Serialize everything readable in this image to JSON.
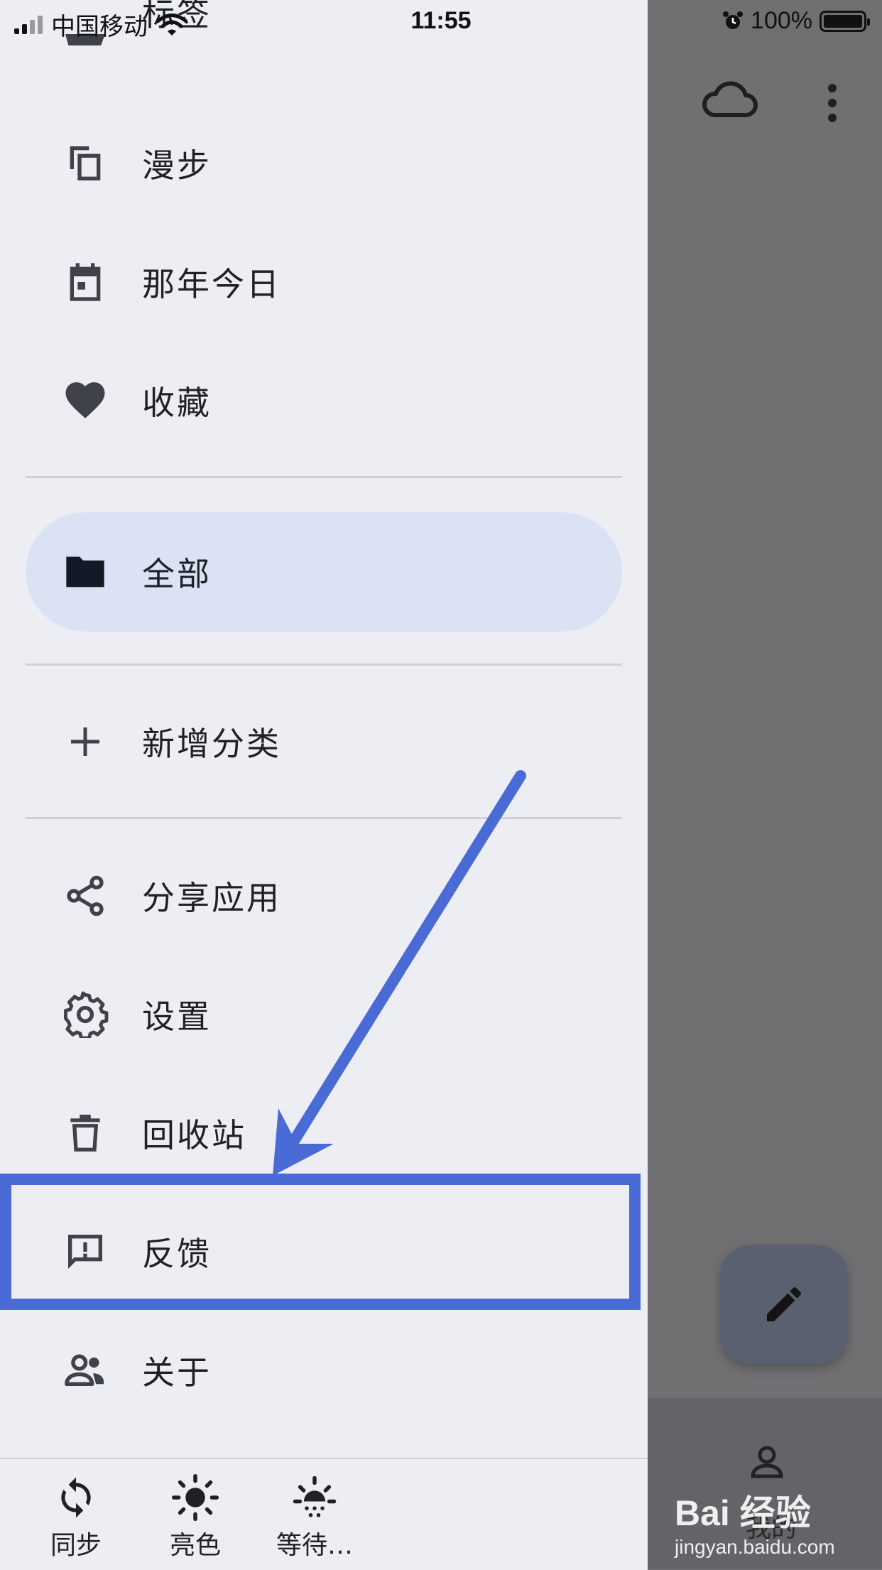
{
  "status_bar": {
    "carrier": "中国移动",
    "time": "11:55",
    "battery": "100%"
  },
  "drawer": {
    "partial_top_label": "标签",
    "items": [
      {
        "label": "漫步",
        "icon": "copy-icon"
      },
      {
        "label": "那年今日",
        "icon": "calendar-icon"
      },
      {
        "label": "收藏",
        "icon": "heart-icon"
      },
      {
        "label": "全部",
        "icon": "folder-icon",
        "active": true
      },
      {
        "label": "新增分类",
        "icon": "plus-icon"
      },
      {
        "label": "分享应用",
        "icon": "share-icon"
      },
      {
        "label": "设置",
        "icon": "gear-icon"
      },
      {
        "label": "回收站",
        "icon": "trash-icon"
      },
      {
        "label": "反馈",
        "icon": "feedback-icon"
      },
      {
        "label": "关于",
        "icon": "people-icon"
      }
    ]
  },
  "bottom_bar": {
    "items": [
      {
        "label": "同步",
        "icon": "sync-icon"
      },
      {
        "label": "亮色",
        "icon": "sun-icon"
      },
      {
        "label": "等待…",
        "icon": "sunrise-icon"
      }
    ]
  },
  "background": {
    "nav_label": "我的"
  },
  "watermark": {
    "main": "Bai 经验",
    "sub": "jingyan.baidu.com"
  },
  "colors": {
    "accent": "#4a6bd6",
    "drawer_bg": "#eceef4",
    "active_bg": "#dae2f4",
    "overlay": "#707073"
  }
}
